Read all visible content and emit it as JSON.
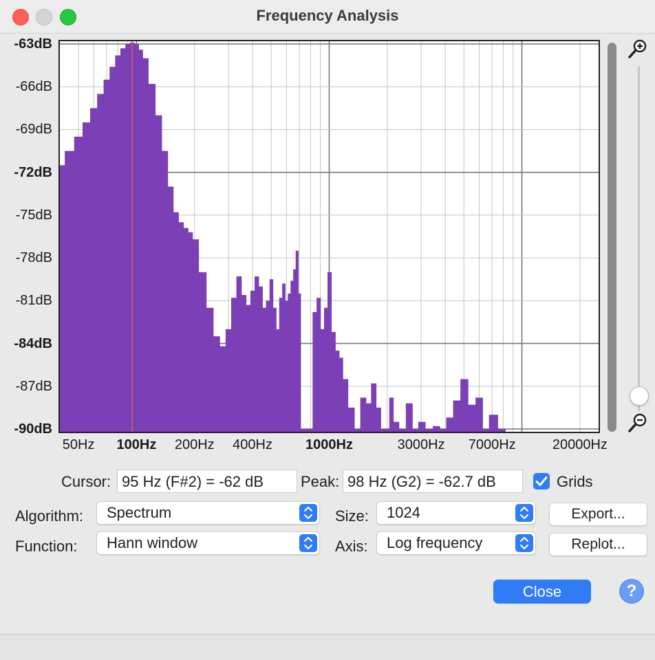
{
  "window": {
    "title": "Frequency Analysis"
  },
  "chart_data": {
    "type": "area",
    "x_scale": "log",
    "xlim": [
      40,
      25000
    ],
    "ylim": [
      -90,
      -63
    ],
    "color": "#7b3fb6",
    "cursor_color": "#e05858",
    "cursor_freq": 95,
    "yticks": [
      {
        "value": -63,
        "label": "-63dB",
        "bold": true
      },
      {
        "value": -66,
        "label": "-66dB",
        "bold": false
      },
      {
        "value": -69,
        "label": "-69dB",
        "bold": false
      },
      {
        "value": -72,
        "label": "-72dB",
        "bold": true
      },
      {
        "value": -75,
        "label": "-75dB",
        "bold": false
      },
      {
        "value": -78,
        "label": "-78dB",
        "bold": false
      },
      {
        "value": -81,
        "label": "-81dB",
        "bold": false
      },
      {
        "value": -84,
        "label": "-84dB",
        "bold": true
      },
      {
        "value": -87,
        "label": "-87dB",
        "bold": false
      },
      {
        "value": -90,
        "label": "-90dB",
        "bold": true
      }
    ],
    "xticks": [
      {
        "value": 50,
        "label": "50Hz",
        "bold": false
      },
      {
        "value": 100,
        "label": "100Hz",
        "bold": true
      },
      {
        "value": 200,
        "label": "200Hz",
        "bold": false
      },
      {
        "value": 400,
        "label": "400Hz",
        "bold": false
      },
      {
        "value": 1000,
        "label": "1000Hz",
        "bold": true
      },
      {
        "value": 3000,
        "label": "3000Hz",
        "bold": false
      },
      {
        "value": 7000,
        "label": "7000Hz",
        "bold": false
      },
      {
        "value": 20000,
        "label": "20000Hz",
        "bold": false
      }
    ],
    "grid": true,
    "x": [
      40,
      45,
      50,
      55,
      60,
      65,
      70,
      75,
      80,
      85,
      90,
      95,
      100,
      105,
      110,
      120,
      130,
      140,
      150,
      160,
      170,
      180,
      190,
      200,
      220,
      240,
      260,
      280,
      300,
      320,
      340,
      360,
      380,
      400,
      420,
      440,
      460,
      480,
      500,
      520,
      540,
      560,
      580,
      600,
      620,
      640,
      660,
      680,
      700,
      720,
      760,
      800,
      840,
      880,
      920,
      960,
      1000,
      1050,
      1100,
      1150,
      1200,
      1300,
      1400,
      1500,
      1600,
      1700,
      1800,
      1900,
      2000,
      2100,
      2200,
      2400,
      2600,
      2800,
      3000,
      3300,
      3600,
      3900,
      4200,
      4600,
      5000,
      5500,
      6000,
      6500,
      7000,
      8000
    ],
    "y": [
      -71.5,
      -70.5,
      -69.5,
      -68.5,
      -67.5,
      -66.5,
      -65.5,
      -64.6,
      -63.8,
      -63.3,
      -63.0,
      -62.9,
      -63.0,
      -63.4,
      -64.0,
      -65.8,
      -68.0,
      -70.5,
      -73.0,
      -74.8,
      -75.5,
      -75.9,
      -76.2,
      -76.7,
      -79.0,
      -81.5,
      -83.5,
      -84.2,
      -83.0,
      -80.8,
      -79.3,
      -80.6,
      -81.3,
      -80.3,
      -79.3,
      -80.0,
      -81.5,
      -81.0,
      -79.5,
      -81.5,
      -83.0,
      -80.8,
      -79.8,
      -81.0,
      -80.5,
      -79.6,
      -78.8,
      -77.5,
      -80.5,
      -90,
      -90,
      -90,
      -81.8,
      -80.8,
      -83.0,
      -81.5,
      -79.0,
      -83.2,
      -84.5,
      -85.0,
      -86.5,
      -88.5,
      -90,
      -87.8,
      -88.2,
      -86.8,
      -88.5,
      -90,
      -90,
      -87.8,
      -89.5,
      -90,
      -88.2,
      -90,
      -89.5,
      -90,
      -89.8,
      -90,
      -89.2,
      -88.0,
      -86.5,
      -88.3,
      -87.8,
      -90,
      -89.0,
      -90
    ]
  },
  "cursor": {
    "label": "Cursor:",
    "value": "95 Hz (F#2) = -62 dB"
  },
  "peak": {
    "label": "Peak:",
    "value": "98 Hz (G2) = -62.7 dB"
  },
  "grids": {
    "label": "Grids",
    "checked": true
  },
  "algorithm": {
    "label": "Algorithm:",
    "value": "Spectrum"
  },
  "function": {
    "label": "Function:",
    "value": "Hann window"
  },
  "size": {
    "label": "Size:",
    "value": "1024"
  },
  "axis": {
    "label": "Axis:",
    "value": "Log frequency"
  },
  "buttons": {
    "export": "Export...",
    "replot": "Replot...",
    "close": "Close",
    "help": "?"
  }
}
